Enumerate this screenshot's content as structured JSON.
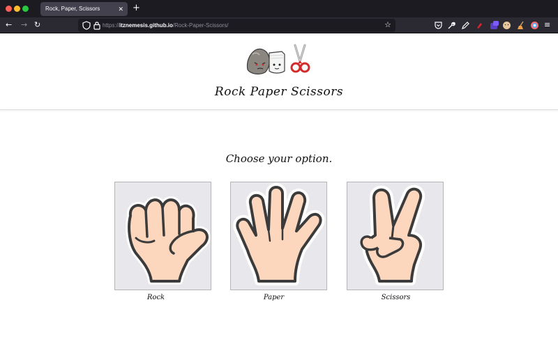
{
  "browser": {
    "tab_title": "Rock, Paper, Scissors",
    "tab_close": "✕",
    "new_tab": "+",
    "url_scheme": "https://",
    "url_host": "itznemesis.github.io",
    "url_path": "/Rock-Paper-Scissors/",
    "back_icon": "←",
    "forward_icon": "→",
    "reload_icon": "↻",
    "star_icon": "☆",
    "menu_icon": "≡"
  },
  "page": {
    "title": "Rock Paper Scissors",
    "prompt": "Choose your option.",
    "options": [
      {
        "id": "rock",
        "label": "Rock"
      },
      {
        "id": "paper",
        "label": "Paper"
      },
      {
        "id": "scissors",
        "label": "Scissors"
      }
    ]
  },
  "colors": {
    "skin": "#fdd7bd",
    "outline": "#3b3b3b",
    "card_bg": "#e8e8ec",
    "scissors_handle": "#d22b2b"
  }
}
